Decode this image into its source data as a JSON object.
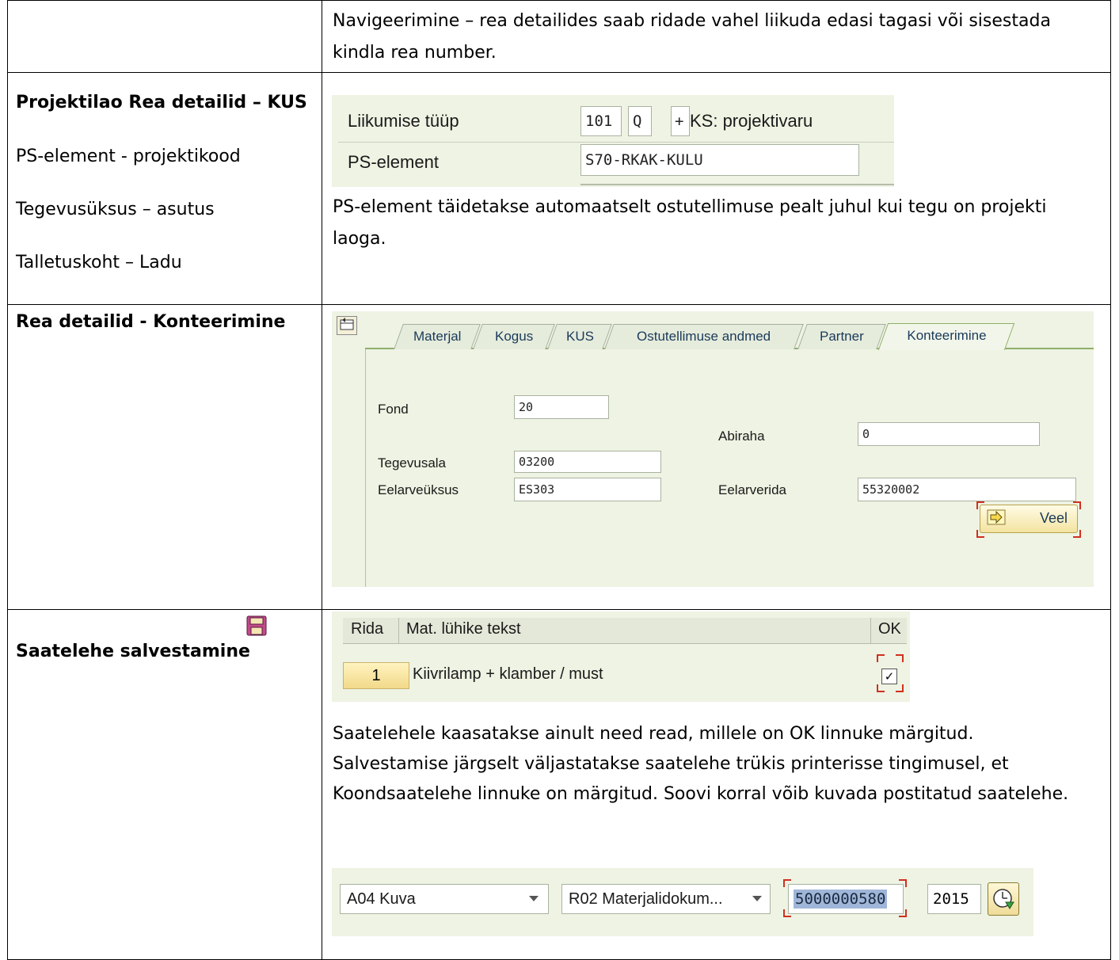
{
  "rows": [
    {
      "left": [],
      "right_text": "Navigeerimine – rea detailides saab ridade vahel liikuda edasi tagasi või sisestada kindla rea number."
    },
    {
      "left": [
        "Projektilao Rea detailid – KUS",
        "PS-element - projektikood",
        "Tegevusüksus – asutus",
        "Talletuskoht – Ladu"
      ],
      "sap": {
        "movement_label": "Liikumise tüüp",
        "movement_code": "101",
        "movement_q": "Q",
        "movement_plus": "+",
        "movement_text": "KS: projektivaru",
        "ps_label": "PS-element",
        "ps_value": "S70-RKAK-KULU"
      },
      "right_text": "PS-element täidetakse automaatselt ostutellimuse pealt juhul kui tegu on projekti laoga."
    },
    {
      "left": [
        "Rea detailid - Konteerimine"
      ],
      "tabs": [
        "Materjal",
        "Kogus",
        "KUS",
        "Ostutellimuse andmed",
        "Partner",
        "Konteerimine"
      ],
      "fields": {
        "fond_label": "Fond",
        "fond_value": "20",
        "abiraha_label": "Abiraha",
        "abiraha_value": "0",
        "tegevusala_label": "Tegevusala",
        "tegevusala_value": "03200",
        "eelarveuksus_label": "Eelarveüksus",
        "eelarveuksus_value": "ES303",
        "eelarverida_label": "Eelarverida",
        "eelarverida_value": "55320002"
      },
      "veel_label": "Veel"
    },
    {
      "left": [
        "Saatelehe salvestamine"
      ],
      "grid": {
        "headers": [
          "Rida",
          "Mat. lühike tekst",
          "OK"
        ],
        "row": {
          "num": "1",
          "text": "Kiivrilamp + klamber / must",
          "ok": "✓"
        }
      },
      "right_text": "Saatelehele kaasatakse ainult need read, millele on OK linnuke märgitud. Salvestamise järgselt väljastatakse saatelehe trükis printerisse tingimusel, et Koondsaatelehe linnuke on märgitud. Soovi korral võib kuvada postitatud saatelehe.",
      "bottom_bar": {
        "select1": "A04 Kuva",
        "select2": "R02 Materjalidokum...",
        "doc_number": "5000000580",
        "year": "2015"
      }
    }
  ],
  "colors": {
    "sap_bg": "#eef3e3",
    "tab_active": "#f2f6ea",
    "highlight": "#9fb6d8",
    "red_marker": "#d03020"
  }
}
